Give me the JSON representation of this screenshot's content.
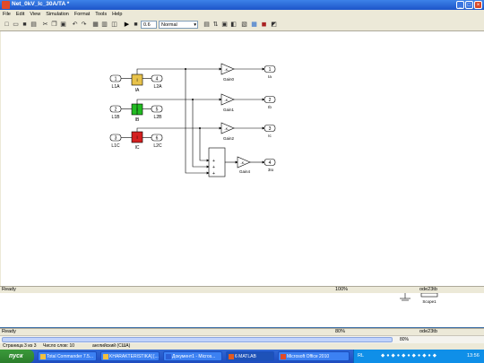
{
  "window": {
    "title": "Net_0kV_Ic_30A/TA *"
  },
  "menu": [
    "File",
    "Edit",
    "View",
    "Simulation",
    "Format",
    "Tools",
    "Help"
  ],
  "toolbar": {
    "stop_time": "0.6",
    "sim_mode": "Normal"
  },
  "blocks": {
    "in1": {
      "num": "1",
      "label": "L1A"
    },
    "in2": {
      "num": "2",
      "label": "L1B"
    },
    "in3": {
      "num": "3",
      "label": "L1C"
    },
    "iA": "IA",
    "iB": "IB",
    "iC": "IC",
    "goto1": {
      "num": "4",
      "label": "L2A"
    },
    "goto2": {
      "num": "5",
      "label": "L2B"
    },
    "goto3": {
      "num": "6",
      "label": "L2C"
    },
    "gain0": "Gain0",
    "gain1": "Gain1",
    "gain2": "Gain2",
    "gain4": "Gain4",
    "out1": {
      "num": "1",
      "label": "Ia"
    },
    "out2": {
      "num": "2",
      "label": "Ib"
    },
    "out3": {
      "num": "3",
      "label": "Ic"
    },
    "out4": {
      "num": "4",
      "label": "3Io"
    },
    "scope": "Scope1"
  },
  "status": {
    "left": "Ready",
    "zoom": "100%",
    "solver": "ode23tb"
  },
  "status2": {
    "left": "Ready",
    "zoom": "80%",
    "solver": "ode23tb"
  },
  "word": {
    "page": "Страница 3 из 3",
    "words": "Число слов: 10",
    "lang": "английский (США)"
  },
  "taskbar": {
    "start": "пуск",
    "tasks": [
      "Total Commander 7.5...",
      "KHARAKTERISTIKA] [...",
      "Документ1 - Micros...",
      "6 MATLAB",
      "Microsoft Office 2010"
    ],
    "lang": "RL",
    "clock": "13:56"
  }
}
